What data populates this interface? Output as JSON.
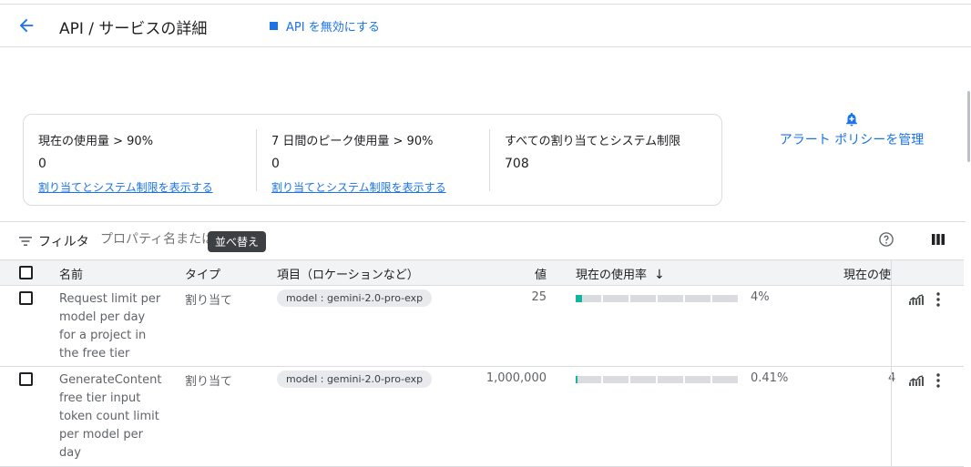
{
  "header": {
    "title": "API / サービスの詳細",
    "disable_label": "API を無効にする"
  },
  "summary": {
    "metrics": [
      {
        "label": "現在の使用量 > 90%",
        "value": "0",
        "link": "割り当てとシステム制限を表示する"
      },
      {
        "label": "7 日間のピーク使用量 > 90%",
        "value": "0",
        "link": "割り当てとシステム制限を表示する"
      },
      {
        "label": "すべての割り当てとシステム制限",
        "value": "708"
      }
    ],
    "alert_policy": "アラート ポリシーを管理"
  },
  "filter": {
    "label": "フィルタ",
    "placeholder": "プロパティ名または",
    "tooltip": "並べ替え"
  },
  "table": {
    "columns": {
      "name": "名前",
      "type": "タイプ",
      "item": "項目（ロケーションなど）",
      "value": "値",
      "usage_rate": "現在の使用率",
      "usage": "現在の使"
    },
    "rows": [
      {
        "name": "Request limit per model per day for a project in the free tier",
        "type": "割り当て",
        "dimension": "model : gemini-2.0-pro-exp",
        "value": "25",
        "usage_fraction": 0.04,
        "usage_label": "4%",
        "cutoff": ""
      },
      {
        "name": "GenerateContent free tier input token count limit per model per day",
        "type": "割り当て",
        "dimension": "model : gemini-2.0-pro-exp",
        "value": "1,000,000",
        "usage_fraction": 0.0041,
        "usage_label": "0.41%",
        "cutoff": "4"
      }
    ]
  },
  "colors": {
    "accent": "#1a73e8",
    "usage_fill": "#12b5a0",
    "border": "#dadce0"
  }
}
